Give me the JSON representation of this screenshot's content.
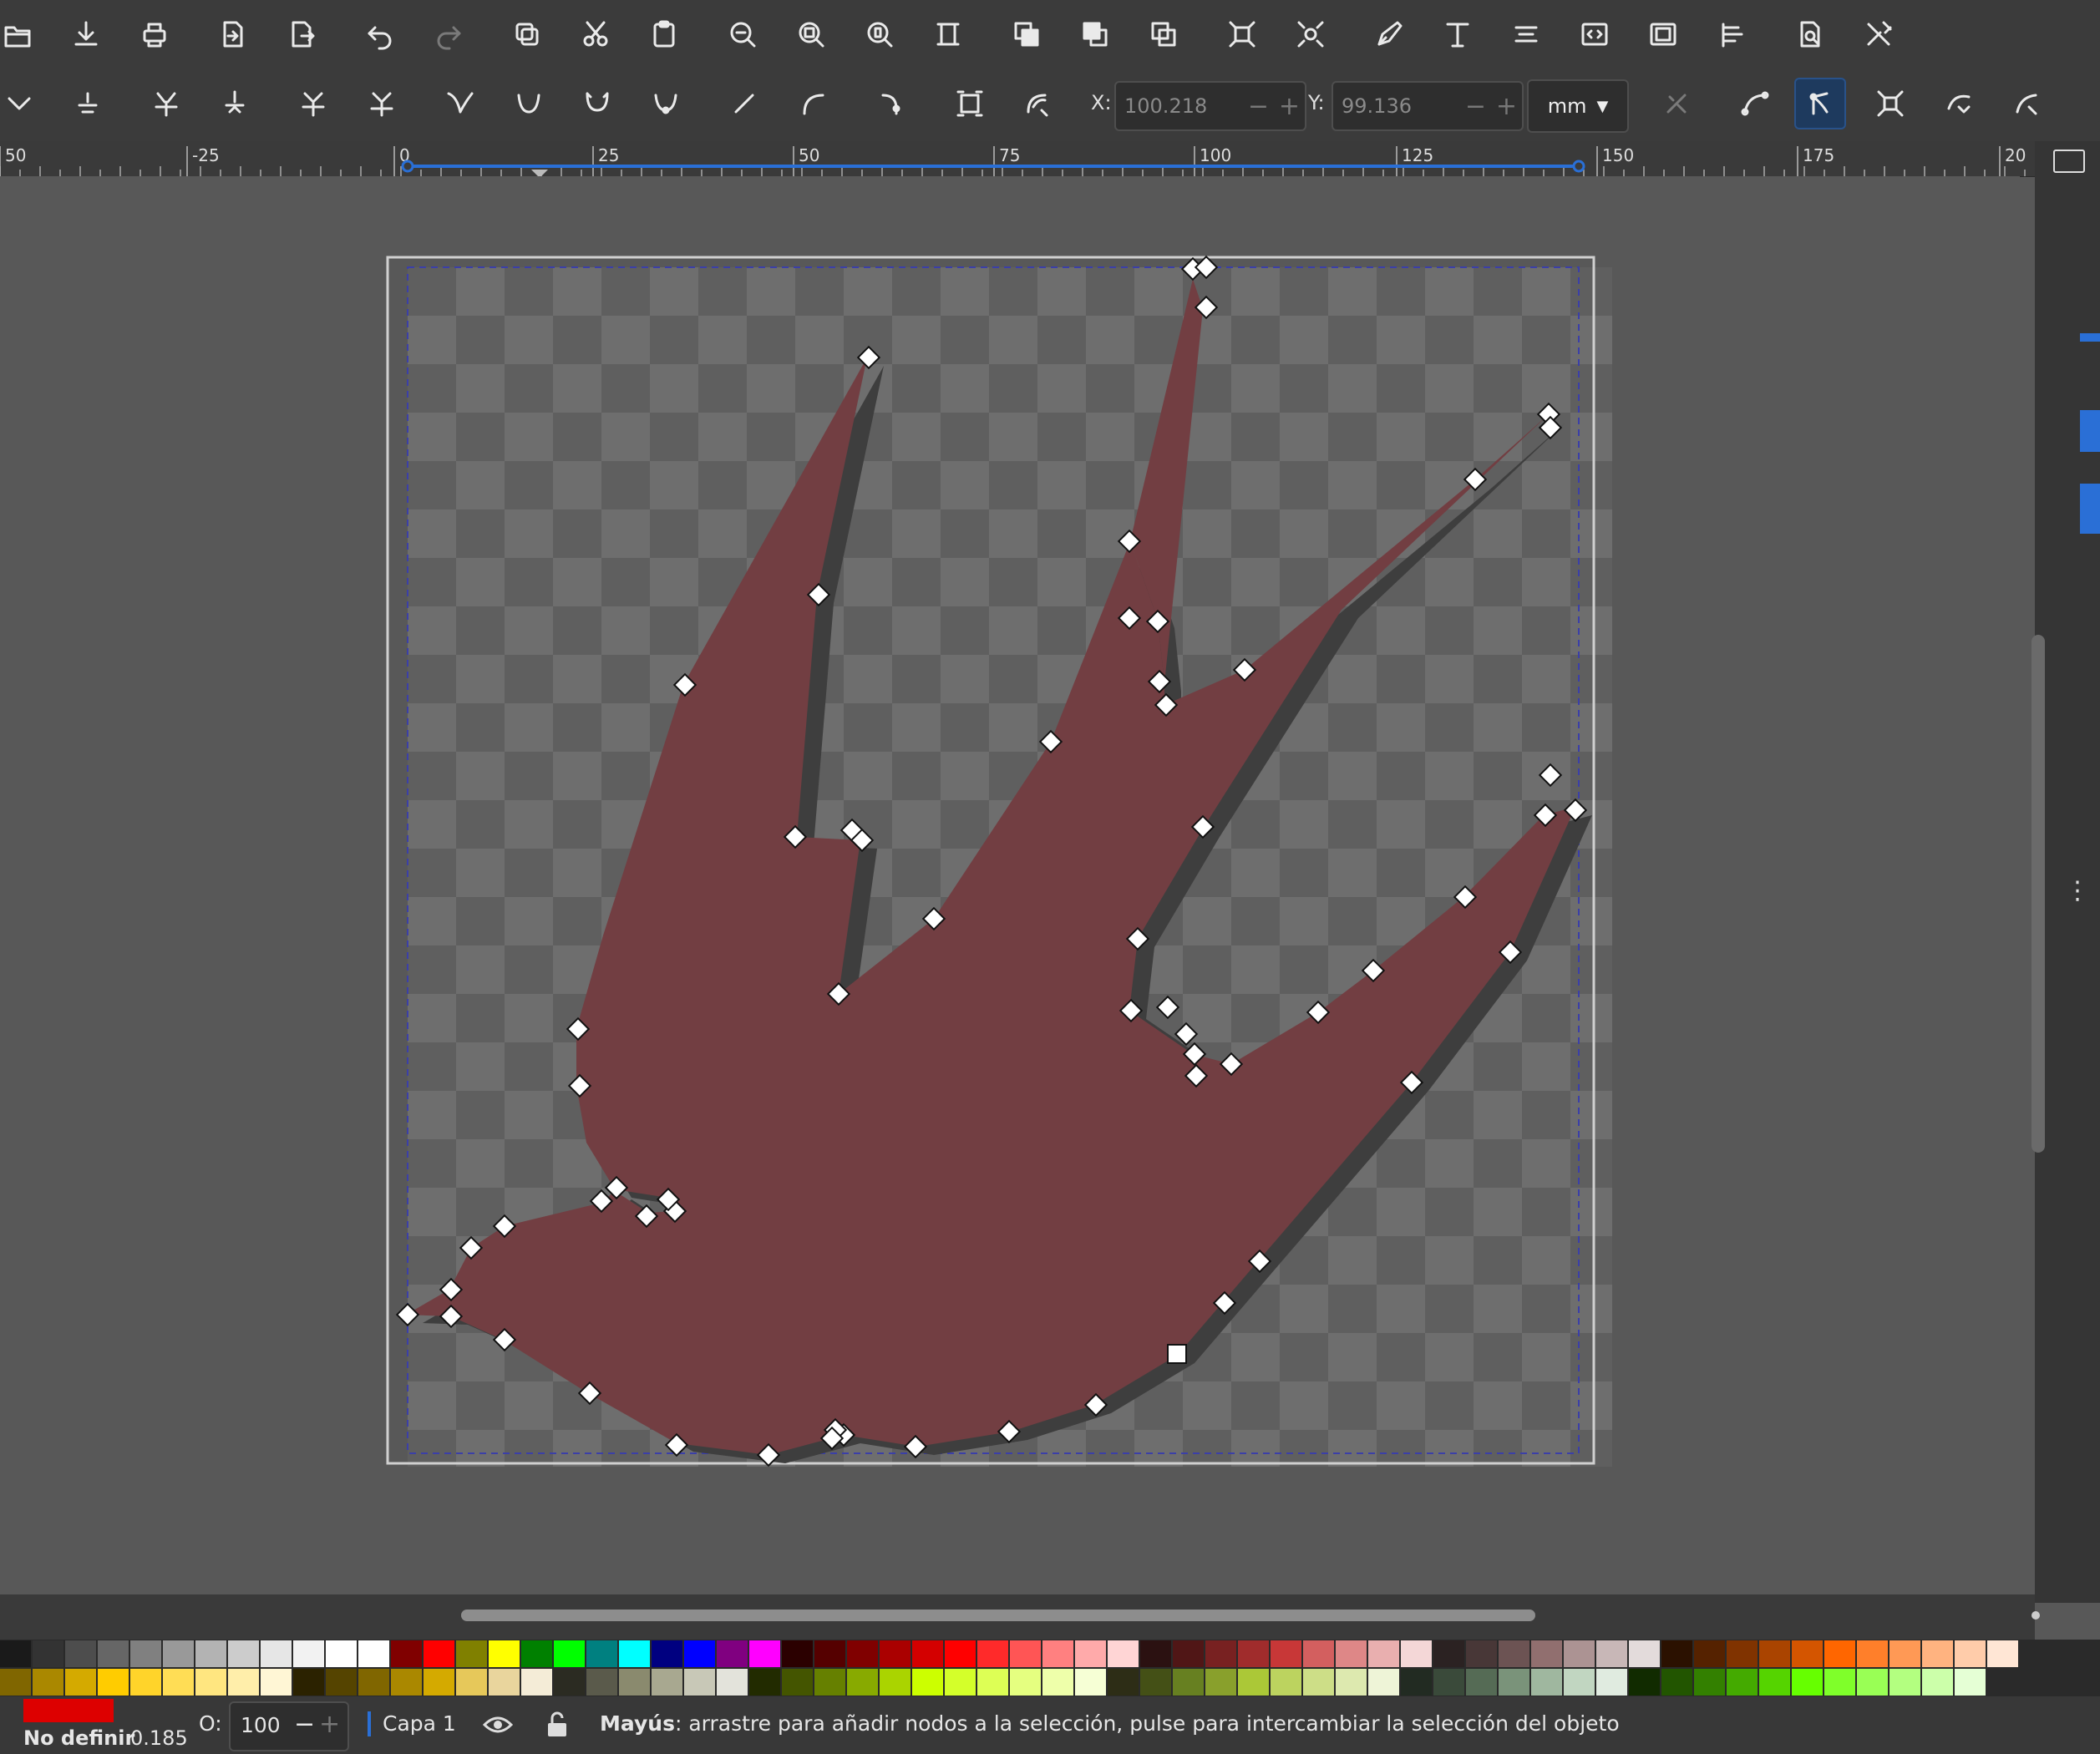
{
  "toolbar": {
    "commands": [
      "open-icon",
      "save-icon",
      "print-icon",
      "import-icon",
      "export-icon",
      "undo-icon",
      "redo-icon",
      "duplicate-icon",
      "cut-icon",
      "paste-icon",
      "zoom-selection-icon",
      "zoom-drawing-icon",
      "zoom-page-icon",
      "zoom-fit-icon",
      "raise-icon",
      "lower-icon",
      "group-icon",
      "ungroup-icon",
      "node-select-icon",
      "pen-icon",
      "text-icon",
      "align-icon",
      "xml-editor-icon",
      "document-properties-icon",
      "layers-icon",
      "preferences-icon",
      "tools-icon"
    ]
  },
  "node_toolbar": {
    "x_label": "X:",
    "x_value": "100.218",
    "y_label": "Y:",
    "y_value": "99.136",
    "unit": "mm"
  },
  "ruler": {
    "labels": [
      "50",
      "-25",
      "0",
      "25",
      "50",
      "75",
      "100",
      "125",
      "150",
      "175",
      "20"
    ]
  },
  "status": {
    "fill_label": "No definir",
    "stroke_width": "0.185",
    "opacity_label": "O:",
    "opacity_value": "100",
    "layer_name": "Capa 1",
    "message_key": "Mayús",
    "message_text": ": arrastre para añadir nodos a la selección, pulse para intercambiar la selección del objeto"
  },
  "colors": {
    "shape_fill": "#723e42",
    "shadow": "#3e3e3e",
    "accent": "#2a6fd6",
    "fill_indicator": "#dd0000"
  }
}
